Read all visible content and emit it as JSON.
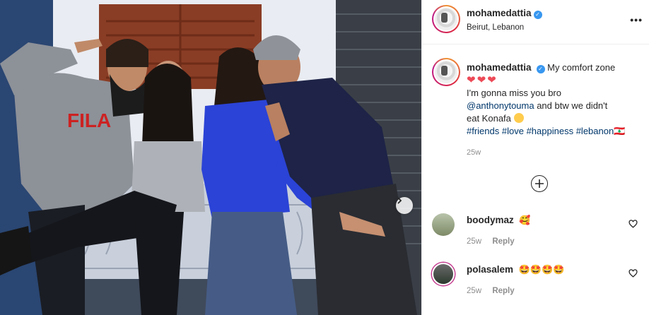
{
  "post": {
    "author": "mohamedattia",
    "location": "Beirut, Lebanon",
    "verified": true
  },
  "caption": {
    "author": "mohamedattia",
    "line1": "My comfort zone",
    "hearts": "❤❤❤",
    "line2": "I'm gonna miss you bro",
    "mention": "@anthonytouma",
    "line3a": " and btw we didn't",
    "line3b": "eat Konafa",
    "hashtags": [
      "#friends",
      "#love",
      "#happiness",
      "#lebanon🇱🇧"
    ],
    "time": "25w"
  },
  "comments": [
    {
      "user": "boodymaz",
      "text": "🥰",
      "time": "25w",
      "reply": "Reply"
    },
    {
      "user": "polasalem",
      "text": "🤩🤩🤩🤩",
      "time": "25w",
      "reply": "Reply"
    }
  ],
  "icons": {
    "more": "more-options-icon",
    "next": "chevron-right-icon",
    "load_more": "plus-circle-icon",
    "like": "heart-outline-icon",
    "verified": "verified-badge-icon"
  },
  "colors": {
    "link": "#00376b",
    "verified": "#3897f0",
    "heart": "#ed4956",
    "muted": "#8e8e8e"
  }
}
